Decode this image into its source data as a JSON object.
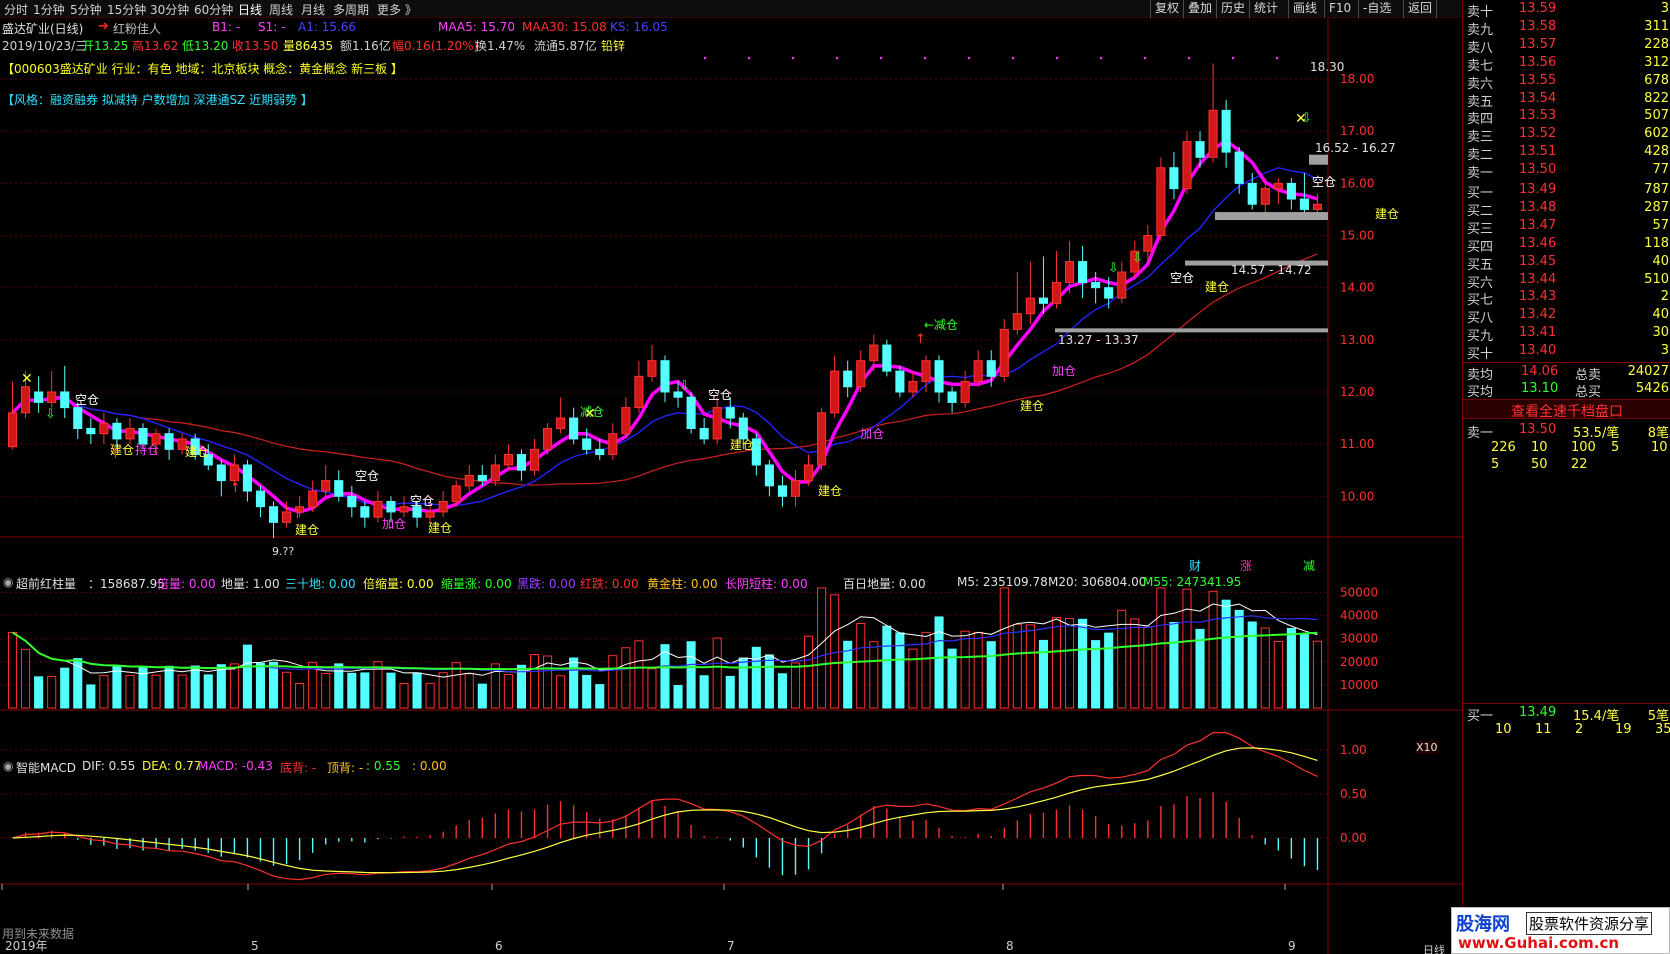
{
  "toolbar": {
    "timeframes": [
      "分时",
      "1分钟",
      "5分钟",
      "15分钟",
      "30分钟",
      "60分钟",
      "日线",
      "周线",
      "月线",
      "多周期",
      "更多 》"
    ],
    "selected": "日线",
    "right_buttons": [
      "复权",
      "叠加",
      "历史",
      "统计",
      "画线",
      "F10",
      "-自选",
      "返回"
    ]
  },
  "header": {
    "stock_title": "盛达矿业(日线)",
    "arrow_icon": "red-up-arrow-icon",
    "concept": "红粉佳人",
    "b1": "B1: -",
    "s1": "S1: -",
    "a1": "A1: 15.66",
    "maa5": "MAA5: 15.70",
    "maa30": "MAA30: 15.08",
    "ks": "KS: 16.05",
    "date": "2019/10/23/三",
    "open": "开13.25",
    "high": "高13.62",
    "low": "低13.20",
    "close": "收13.50",
    "volume": "量86435",
    "amount": "额1.16亿",
    "change": "幅0.16(1.20%)",
    "turnover": "换1.47%",
    "float": "流通5.87亿",
    "metal": "铅锌",
    "industry_line": "【000603盛达矿业 行业：有色 地域：北京板块 概念：黄金概念 新三板 】",
    "style_line": "【风格：融资融券 拟减持 户数增加 深港通SZ 近期弱势 】"
  },
  "price_axis": [
    "18.00",
    "17.00",
    "16.00",
    "15.00",
    "14.00",
    "13.00",
    "12.00",
    "11.00",
    "10.00"
  ],
  "price_annotations": {
    "high": "18.30",
    "low": "9.??",
    "zone1": "16.52 - 16.27",
    "zone2": "14.57 - 14.72",
    "zone3": "13.27 - 13.37"
  },
  "signals": {
    "empty": "空仓",
    "build": "建仓",
    "reduce": "减仓",
    "reduce_arrow": "←减仓",
    "add": "加仓",
    "hold": "持仓"
  },
  "chart_data": {
    "type": "candlestick",
    "title": "盛达矿业(日线)",
    "ylim": [
      9.2,
      18.5
    ],
    "x_labels": [
      "2019年",
      "5",
      "6",
      "7",
      "8",
      "9"
    ],
    "candles": [
      [
        10.95,
        11.6,
        12.2,
        10.9
      ],
      [
        11.6,
        12.1,
        12.4,
        11.5
      ],
      [
        12.0,
        11.8,
        12.3,
        11.6
      ],
      [
        11.8,
        12.0,
        12.4,
        11.7
      ],
      [
        12.0,
        11.7,
        12.5,
        11.5
      ],
      [
        11.7,
        11.3,
        11.8,
        11.1
      ],
      [
        11.3,
        11.2,
        11.5,
        11.0
      ],
      [
        11.2,
        11.4,
        11.6,
        11.0
      ],
      [
        11.4,
        11.1,
        11.5,
        10.9
      ],
      [
        11.1,
        11.3,
        11.5,
        11.0
      ],
      [
        11.3,
        11.0,
        11.4,
        10.9
      ],
      [
        11.0,
        11.2,
        11.3,
        10.8
      ],
      [
        11.2,
        10.9,
        11.3,
        10.7
      ],
      [
        10.9,
        11.1,
        11.2,
        10.8
      ],
      [
        11.1,
        10.8,
        11.2,
        10.7
      ],
      [
        10.8,
        10.6,
        11.0,
        10.5
      ],
      [
        10.6,
        10.3,
        10.7,
        10.0
      ],
      [
        10.3,
        10.6,
        10.8,
        10.2
      ],
      [
        10.6,
        10.1,
        10.7,
        9.9
      ],
      [
        10.1,
        9.8,
        10.2,
        9.6
      ],
      [
        9.8,
        9.5,
        9.9,
        9.2
      ],
      [
        9.5,
        9.7,
        9.9,
        9.4
      ],
      [
        9.7,
        9.8,
        10.0,
        9.6
      ],
      [
        9.8,
        10.1,
        10.3,
        9.7
      ],
      [
        10.1,
        10.3,
        10.6,
        10.0
      ],
      [
        10.3,
        10.0,
        10.5,
        9.9
      ],
      [
        10.0,
        9.8,
        10.2,
        9.6
      ],
      [
        9.8,
        9.6,
        9.9,
        9.4
      ],
      [
        9.6,
        9.9,
        10.1,
        9.5
      ],
      [
        9.9,
        9.7,
        10.0,
        9.5
      ],
      [
        9.7,
        9.8,
        10.0,
        9.6
      ],
      [
        9.8,
        9.6,
        9.9,
        9.4
      ],
      [
        9.6,
        9.7,
        9.9,
        9.5
      ],
      [
        9.7,
        9.9,
        10.1,
        9.6
      ],
      [
        9.9,
        10.2,
        10.3,
        9.8
      ],
      [
        10.2,
        10.4,
        10.6,
        10.1
      ],
      [
        10.4,
        10.3,
        10.6,
        10.2
      ],
      [
        10.3,
        10.6,
        10.8,
        10.2
      ],
      [
        10.6,
        10.8,
        11.0,
        10.5
      ],
      [
        10.8,
        10.5,
        10.9,
        10.3
      ],
      [
        10.5,
        10.9,
        11.1,
        10.4
      ],
      [
        10.9,
        11.3,
        11.4,
        10.8
      ],
      [
        11.3,
        11.5,
        11.9,
        11.2
      ],
      [
        11.5,
        11.1,
        11.7,
        11.0
      ],
      [
        11.1,
        10.9,
        11.3,
        10.8
      ],
      [
        10.9,
        10.8,
        11.1,
        10.7
      ],
      [
        10.8,
        11.2,
        11.4,
        10.7
      ],
      [
        11.2,
        11.7,
        11.9,
        11.1
      ],
      [
        11.7,
        12.3,
        12.6,
        11.6
      ],
      [
        12.3,
        12.6,
        12.9,
        12.2
      ],
      [
        12.6,
        12.0,
        12.7,
        11.8
      ],
      [
        12.0,
        11.9,
        12.2,
        11.7
      ],
      [
        11.9,
        11.3,
        12.0,
        11.2
      ],
      [
        11.3,
        11.1,
        11.5,
        11.0
      ],
      [
        11.1,
        11.7,
        11.9,
        11.0
      ],
      [
        11.7,
        11.5,
        11.9,
        11.3
      ],
      [
        11.5,
        11.1,
        11.6,
        10.9
      ],
      [
        11.1,
        10.6,
        11.2,
        10.4
      ],
      [
        10.6,
        10.2,
        10.7,
        10.0
      ],
      [
        10.2,
        10.0,
        10.4,
        9.8
      ],
      [
        10.0,
        10.3,
        10.5,
        9.8
      ],
      [
        10.3,
        10.6,
        10.8,
        10.2
      ],
      [
        10.6,
        11.6,
        11.7,
        10.5
      ],
      [
        11.6,
        12.4,
        12.7,
        11.5
      ],
      [
        12.4,
        12.1,
        12.6,
        11.9
      ],
      [
        12.1,
        12.6,
        12.8,
        12.0
      ],
      [
        12.6,
        12.9,
        13.1,
        12.4
      ],
      [
        12.9,
        12.4,
        13.0,
        12.3
      ],
      [
        12.4,
        12.0,
        12.5,
        11.9
      ],
      [
        12.0,
        12.2,
        12.4,
        11.9
      ],
      [
        12.2,
        12.6,
        12.7,
        12.0
      ],
      [
        12.6,
        12.0,
        12.7,
        11.8
      ],
      [
        12.0,
        11.8,
        12.1,
        11.6
      ],
      [
        11.8,
        12.2,
        12.4,
        11.7
      ],
      [
        12.2,
        12.6,
        12.8,
        12.1
      ],
      [
        12.6,
        12.3,
        12.8,
        12.1
      ],
      [
        12.3,
        13.2,
        13.4,
        12.2
      ],
      [
        13.2,
        13.5,
        14.3,
        13.1
      ],
      [
        13.5,
        13.8,
        14.5,
        13.3
      ],
      [
        13.8,
        13.7,
        14.6,
        13.5
      ],
      [
        13.7,
        14.1,
        14.7,
        13.6
      ],
      [
        14.1,
        14.5,
        14.9,
        13.9
      ],
      [
        14.5,
        14.1,
        14.8,
        13.8
      ],
      [
        14.1,
        14.0,
        14.3,
        13.7
      ],
      [
        14.0,
        13.8,
        14.2,
        13.6
      ],
      [
        13.8,
        14.3,
        14.5,
        13.7
      ],
      [
        14.3,
        14.7,
        14.9,
        14.2
      ],
      [
        14.7,
        15.0,
        15.2,
        14.5
      ],
      [
        15.0,
        16.3,
        16.5,
        14.9
      ],
      [
        16.3,
        15.9,
        16.6,
        15.7
      ],
      [
        15.9,
        16.8,
        17.0,
        15.8
      ],
      [
        16.8,
        16.5,
        17.0,
        16.3
      ],
      [
        16.5,
        17.4,
        18.3,
        16.4
      ],
      [
        17.4,
        16.6,
        17.6,
        16.3
      ],
      [
        16.6,
        16.0,
        16.7,
        15.8
      ],
      [
        16.0,
        15.6,
        16.2,
        15.5
      ],
      [
        15.6,
        15.9,
        16.1,
        15.4
      ],
      [
        15.9,
        16.0,
        16.1,
        15.6
      ],
      [
        16.0,
        15.7,
        16.1,
        15.5
      ],
      [
        15.7,
        15.5,
        16.2,
        15.3
      ],
      [
        15.5,
        15.6,
        15.8,
        15.4
      ]
    ],
    "volume_series": {
      "title": "超前红柱量",
      "value": "158687.95",
      "m5": "M5: 235109.78",
      "m20": "M20: 306804.00",
      "m55": "M55: 247341.95"
    },
    "volume_axis": [
      "50000",
      "40000",
      "30000",
      "20000",
      "10000"
    ],
    "volume_unit": "X10",
    "macd": {
      "title": "智能MACD",
      "dif": "DIF: 0.55",
      "dea": "DEA: 0.77",
      "macd": "MACD: -0.43",
      "bottom_div": "底背: -",
      "top_div": "顶背: -",
      "v1": ": 0.55",
      "v2": ": 0.00"
    },
    "macd_axis": [
      "1.00",
      "0.50",
      "0.00"
    ]
  },
  "vol_legend": {
    "beishuliang": "倍量: 0.00",
    "diliang": "地量: 1.00",
    "sanshidi": "三十地: 0.00",
    "beisuo": "倍缩量: 0.00",
    "suozhang": "缩量涨: 0.00",
    "heidie": "黑跌: 0.00",
    "hongdie": "红跌: 0.00",
    "huangjin": "黄金柱: 0.00",
    "changyin": "长阴短柱: 0.00",
    "bairi": "百日地量: 0.00"
  },
  "markers": {
    "cai": "财",
    "zhang": "涨",
    "jian": "减"
  },
  "footer": {
    "note": "用到未来数据",
    "period": "日线"
  },
  "orderbook": {
    "asks": [
      [
        "卖十",
        "13.59",
        "3"
      ],
      [
        "卖九",
        "13.58",
        "311"
      ],
      [
        "卖八",
        "13.57",
        "228"
      ],
      [
        "卖七",
        "13.56",
        "312"
      ],
      [
        "卖六",
        "13.55",
        "678"
      ],
      [
        "卖五",
        "13.54",
        "822"
      ],
      [
        "卖四",
        "13.53",
        "507"
      ],
      [
        "卖三",
        "13.52",
        "602"
      ],
      [
        "卖二",
        "13.51",
        "428"
      ],
      [
        "卖一",
        "13.50",
        "77"
      ]
    ],
    "bids": [
      [
        "买一",
        "13.49",
        "787"
      ],
      [
        "买二",
        "13.48",
        "287"
      ],
      [
        "买三",
        "13.47",
        "57"
      ],
      [
        "买四",
        "13.46",
        "118"
      ],
      [
        "买五",
        "13.45",
        "40"
      ],
      [
        "买六",
        "13.44",
        "510"
      ],
      [
        "买七",
        "13.43",
        "2"
      ],
      [
        "买八",
        "13.42",
        "40"
      ],
      [
        "买九",
        "13.41",
        "30"
      ],
      [
        "买十",
        "13.40",
        "3"
      ]
    ],
    "avg_sell_label": "卖均",
    "avg_sell": "14.06",
    "total_sell_label": "总卖",
    "total_sell": "24027",
    "avg_buy_label": "买均",
    "avg_buy": "13.10",
    "total_buy_label": "总买",
    "total_buy": "5426",
    "view_all": "查看全速千档盘口",
    "sell1_label": "卖一",
    "sell1_price": "13.50",
    "sell1_rate": "53.5/笔",
    "sell1_count": "8笔",
    "sell_queue": [
      [
        "226",
        "10",
        "100",
        "5",
        "10"
      ],
      [
        "5",
        "50",
        "22",
        "",
        ""
      ]
    ],
    "buy1_label": "买一",
    "buy1_price": "13.49",
    "buy1_rate": "15.4/笔",
    "buy1_count": "5笔",
    "buy_queue": [
      "10",
      "11",
      "2",
      "19",
      "35"
    ]
  },
  "watermark": {
    "left": "股海网",
    "right": "股票软件资源分享",
    "url": "www.Guhai.com.cn"
  },
  "colors": {
    "up": "#ff3232",
    "down": "#54ffff",
    "ma5": "#ff00ff",
    "ma_blue": "#2222ff",
    "ma_red": "#d02020",
    "signal_yellow": "#ffff00",
    "grid": "#550000"
  }
}
